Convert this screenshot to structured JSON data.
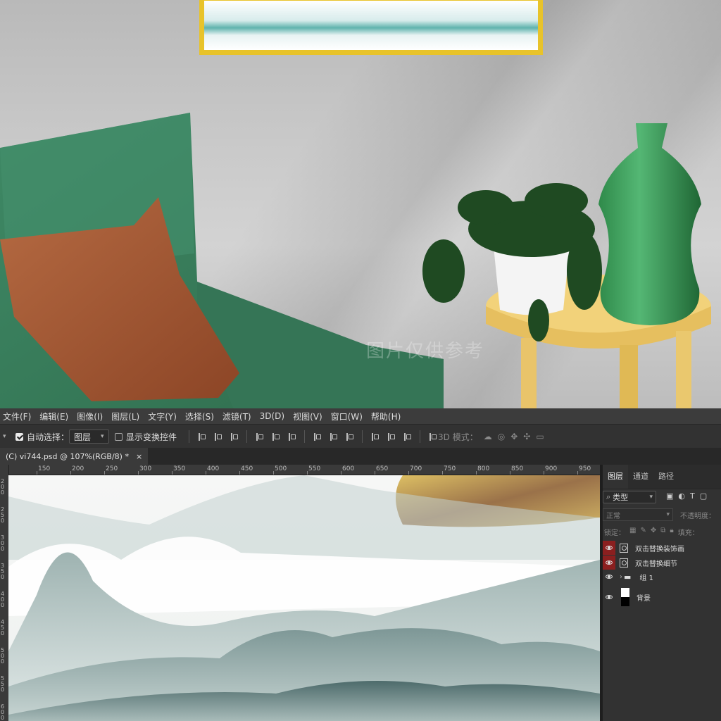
{
  "photo": {
    "watermark_line": "图片仅供参考"
  },
  "menu": [
    "文件(F)",
    "编辑(E)",
    "图像(I)",
    "图层(L)",
    "文字(Y)",
    "选择(S)",
    "滤镜(T)",
    "3D(D)",
    "视图(V)",
    "窗口(W)",
    "帮助(H)"
  ],
  "options": {
    "auto_select_label": "自动选择：",
    "auto_select_target": "图层",
    "show_transform_label": "显示变换控件",
    "mode_3d_label": "3D 模式："
  },
  "document": {
    "tab_title": "(C) vi744.psd @ 107%(RGB/8) *",
    "close_glyph": "×"
  },
  "ruler": {
    "h_ticks": [
      "150",
      "200",
      "250",
      "300",
      "350",
      "400",
      "450",
      "500",
      "550",
      "600",
      "650",
      "700",
      "750",
      "800",
      "850",
      "900",
      "950"
    ],
    "v_ticks": [
      "200",
      "250",
      "300",
      "350",
      "400",
      "450",
      "500",
      "550",
      "600"
    ]
  },
  "layers_panel": {
    "tabs": [
      "图层",
      "通道",
      "路径"
    ],
    "filter_label": "类型",
    "blend_mode": "正常",
    "opacity_label": "不透明度：",
    "lock_label": "锁定：",
    "fill_label": "填充：",
    "layers": [
      {
        "name": "双击替换装饰画",
        "type": "smart",
        "visible_highlight": true
      },
      {
        "name": "双击替换细节",
        "type": "smart",
        "visible_highlight": true
      },
      {
        "name": "组 1",
        "type": "group",
        "visible_highlight": false
      },
      {
        "name": "背景",
        "type": "background",
        "visible_highlight": false
      }
    ]
  },
  "colors": {
    "ps_dark": "#323232",
    "eye_highlight": "#8b1f1f",
    "frame_gold": "#e8c32a",
    "chair_green": "#3f7f5c",
    "pillow_brown": "#a0522d"
  }
}
